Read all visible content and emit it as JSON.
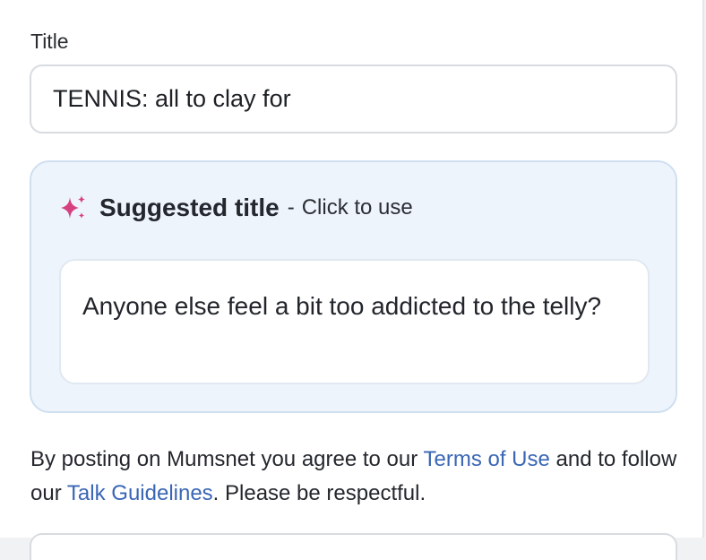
{
  "title_field": {
    "label": "Title",
    "value": "TENNIS: all to clay for"
  },
  "suggestion": {
    "heading": "Suggested title",
    "separator": "-",
    "hint": "Click to use",
    "text": "Anyone else feel a bit too addicted to the telly?",
    "icon": "sparkle-icon",
    "icon_color": "#d6417f"
  },
  "terms": {
    "prefix": "By posting on Mumsnet you agree to our ",
    "terms_link": "Terms of Use",
    "middle": " and to follow our ",
    "guidelines_link": "Talk Guidelines",
    "suffix": ". Please be respectful.",
    "link_color": "#3a66b5"
  }
}
